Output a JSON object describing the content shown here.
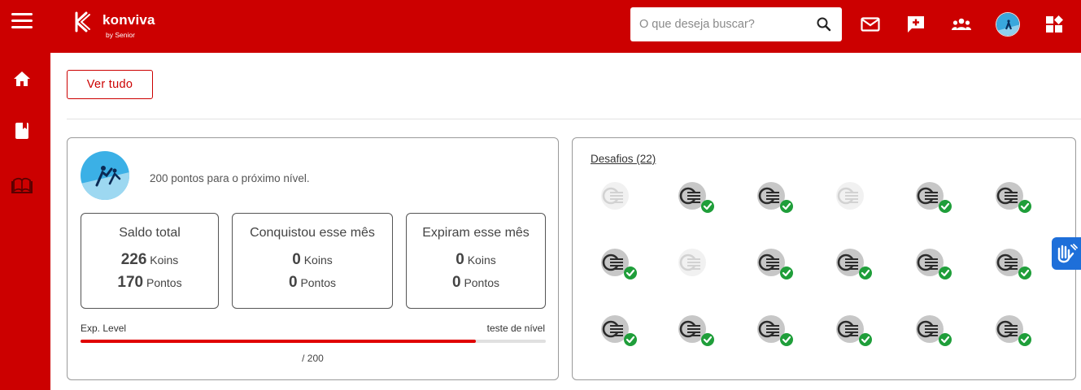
{
  "app": {
    "brand": "konviva",
    "brand_sub": "by Senior",
    "colors": {
      "primary": "#cc0000",
      "check": "#1f9e3a",
      "accessibility": "#1e6fd9"
    }
  },
  "header": {
    "search": {
      "placeholder": "O que deseja buscar?",
      "value": ""
    },
    "icons": [
      "menu-icon",
      "search-icon",
      "mail-icon",
      "message-plus-icon",
      "group-icon",
      "avatar",
      "grid-add-icon"
    ]
  },
  "sidebar": {
    "items": [
      {
        "icon": "home-icon"
      },
      {
        "icon": "book-icon"
      },
      {
        "icon": "library-icon"
      }
    ]
  },
  "main": {
    "ver_tudo": "Ver tudo",
    "level": {
      "next_level_text": "200 pontos para o próximo nível.",
      "stats": [
        {
          "title": "Saldo total",
          "koins": "226",
          "koins_label": "Koins",
          "pontos": "170",
          "pontos_label": "Pontos"
        },
        {
          "title": "Conquistou esse mês",
          "koins": "0",
          "koins_label": "Koins",
          "pontos": "0",
          "pontos_label": "Pontos"
        },
        {
          "title": "Expiram esse mês",
          "koins": "0",
          "koins_label": "Koins",
          "pontos": "0",
          "pontos_label": "Pontos"
        }
      ],
      "exp_label": "Exp. Level",
      "exp_right": "teste de nível",
      "progress_fraction": 0.85,
      "progress_caption": "/ 200"
    },
    "desafios": {
      "title": "Desafios (22)",
      "badges": [
        {
          "completed": false
        },
        {
          "completed": true
        },
        {
          "completed": true
        },
        {
          "completed": false
        },
        {
          "completed": true
        },
        {
          "completed": true
        },
        {
          "completed": true
        },
        {
          "completed": false
        },
        {
          "completed": true
        },
        {
          "completed": true
        },
        {
          "completed": true
        },
        {
          "completed": true
        },
        {
          "completed": true
        },
        {
          "completed": true
        },
        {
          "completed": true
        },
        {
          "completed": true
        },
        {
          "completed": true
        },
        {
          "completed": true
        }
      ]
    }
  },
  "accessibility_tab": {
    "icon": "hand-sign-icon"
  }
}
